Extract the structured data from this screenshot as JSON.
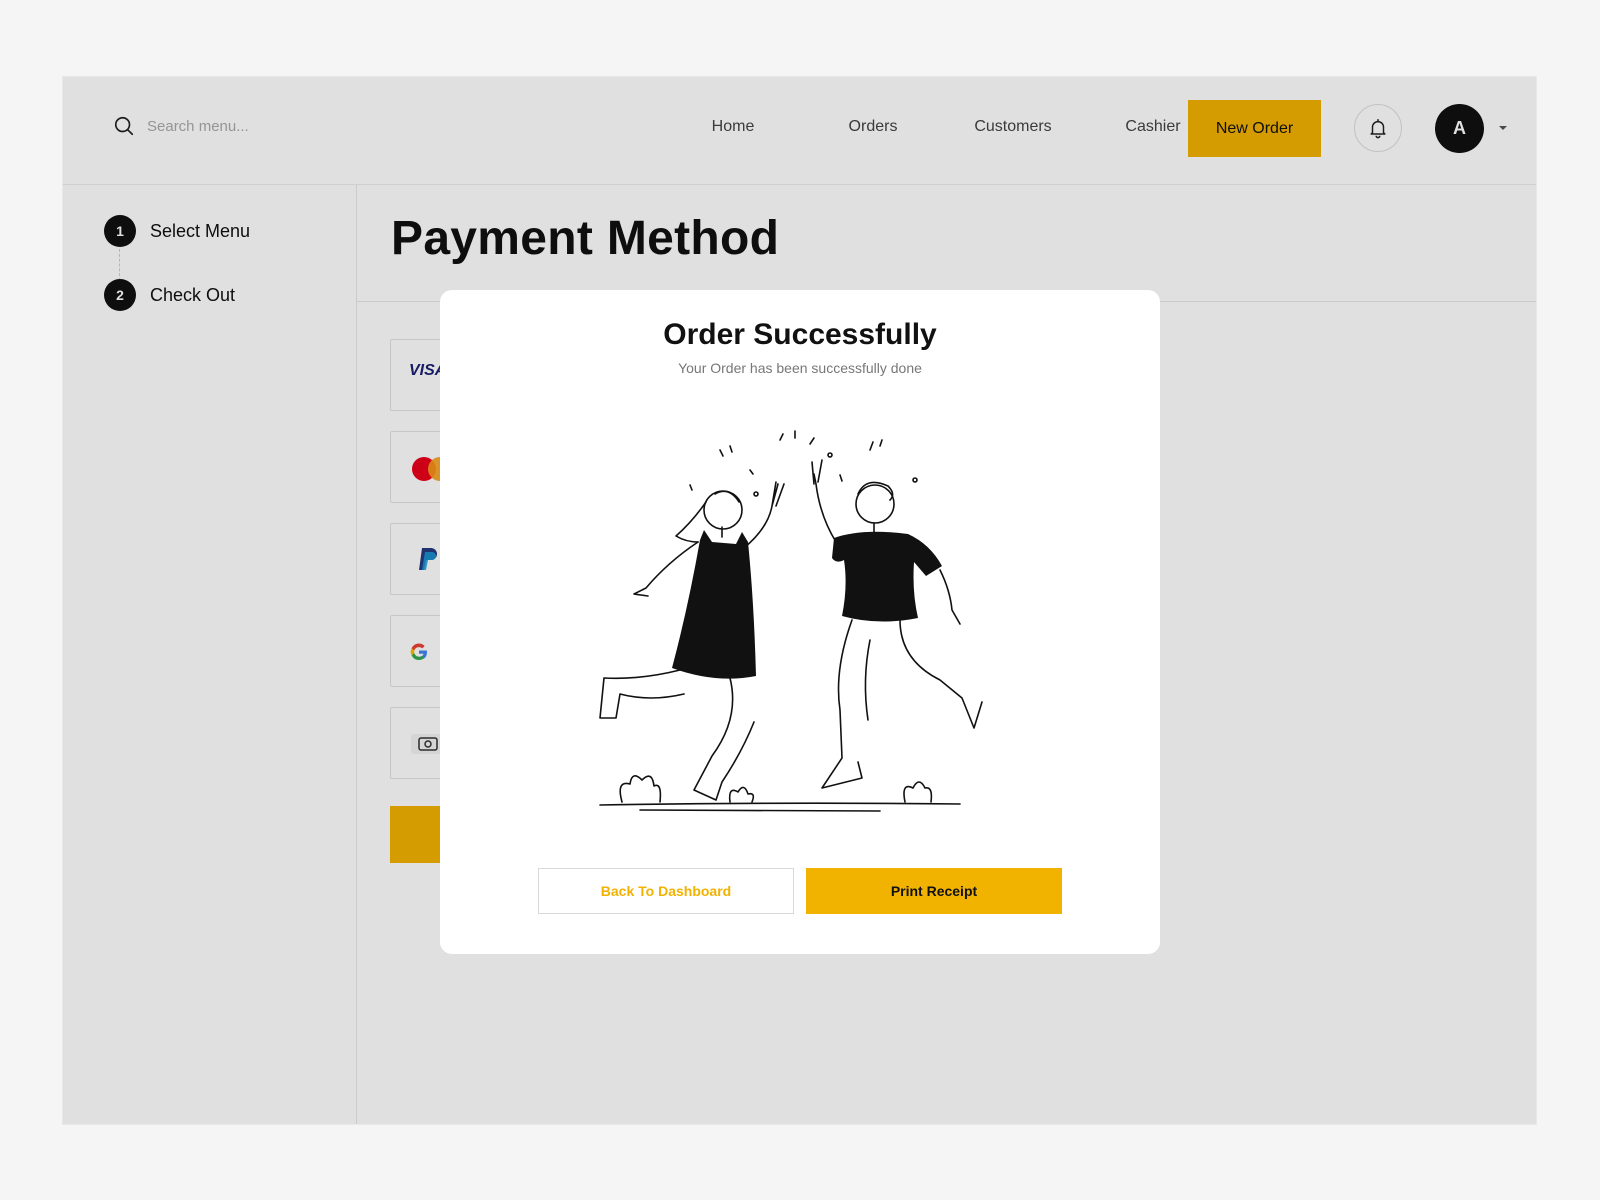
{
  "search": {
    "placeholder": "Search menu..."
  },
  "nav": {
    "items": [
      "Home",
      "Orders",
      "Customers",
      "Cashier"
    ],
    "new_order_label": "New Order"
  },
  "user": {
    "avatar_initial": "A"
  },
  "steps": [
    {
      "number": "1",
      "label": "Select Menu"
    },
    {
      "number": "2",
      "label": "Check Out"
    }
  ],
  "page": {
    "title": "Payment Method"
  },
  "payment_methods": [
    {
      "name": "visa",
      "logo_text": "VISA"
    },
    {
      "name": "mastercard"
    },
    {
      "name": "paypal"
    },
    {
      "name": "google-pay"
    },
    {
      "name": "cash"
    }
  ],
  "modal": {
    "title": "Order Successfully",
    "subtitle": "Your Order has been successfully done",
    "back_label": "Back To Dashboard",
    "print_label": "Print Receipt"
  },
  "colors": {
    "accent": "#f2b200",
    "dark": "#111111",
    "overlay": "rgba(0,0,0,0.12)"
  }
}
